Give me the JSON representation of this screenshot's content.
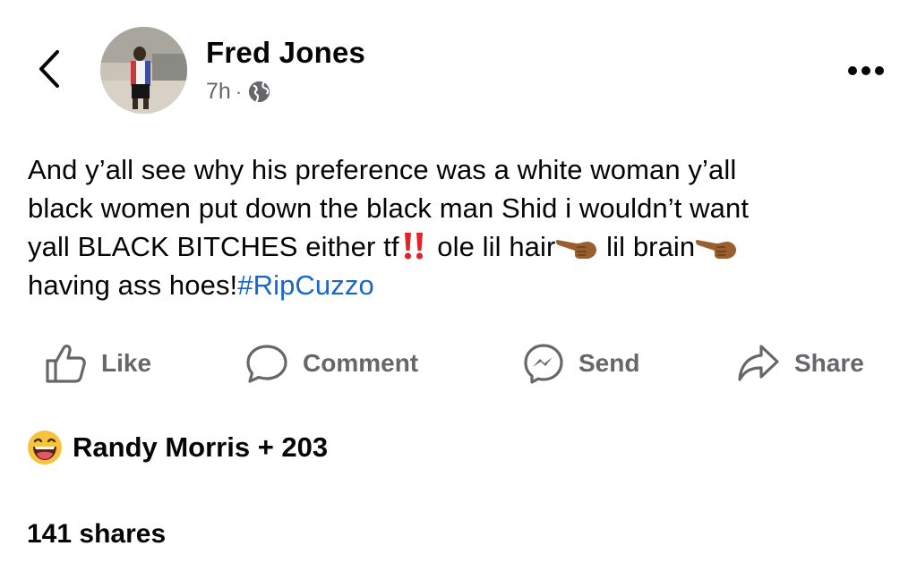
{
  "post": {
    "author": "Fred Jones",
    "time": "7h",
    "separator": "·",
    "privacy_icon": "globe-icon",
    "text_lines": [
      "And y’all see why his preference was a white woman y’all",
      "black women put down the black man Shid i wouldn’t want",
      "yall BLACK BITCHES either tf",
      "having ass hoes!"
    ],
    "text_segments": {
      "line3_after_bangbang": " ole lil hair",
      "line3_after_point1": " lil brain"
    },
    "hashtag": "#RipCuzzo"
  },
  "actions": {
    "like": "Like",
    "comment": "Comment",
    "send": "Send",
    "share": "Share"
  },
  "reactions": {
    "emoji": "laughing-face-icon",
    "names": "Randy Morris + 203"
  },
  "shares": "141 shares",
  "colors": {
    "text": "#050505",
    "secondary": "#65676b",
    "hashtag": "#1a67c9",
    "emphasis_red": "#e0242a"
  }
}
